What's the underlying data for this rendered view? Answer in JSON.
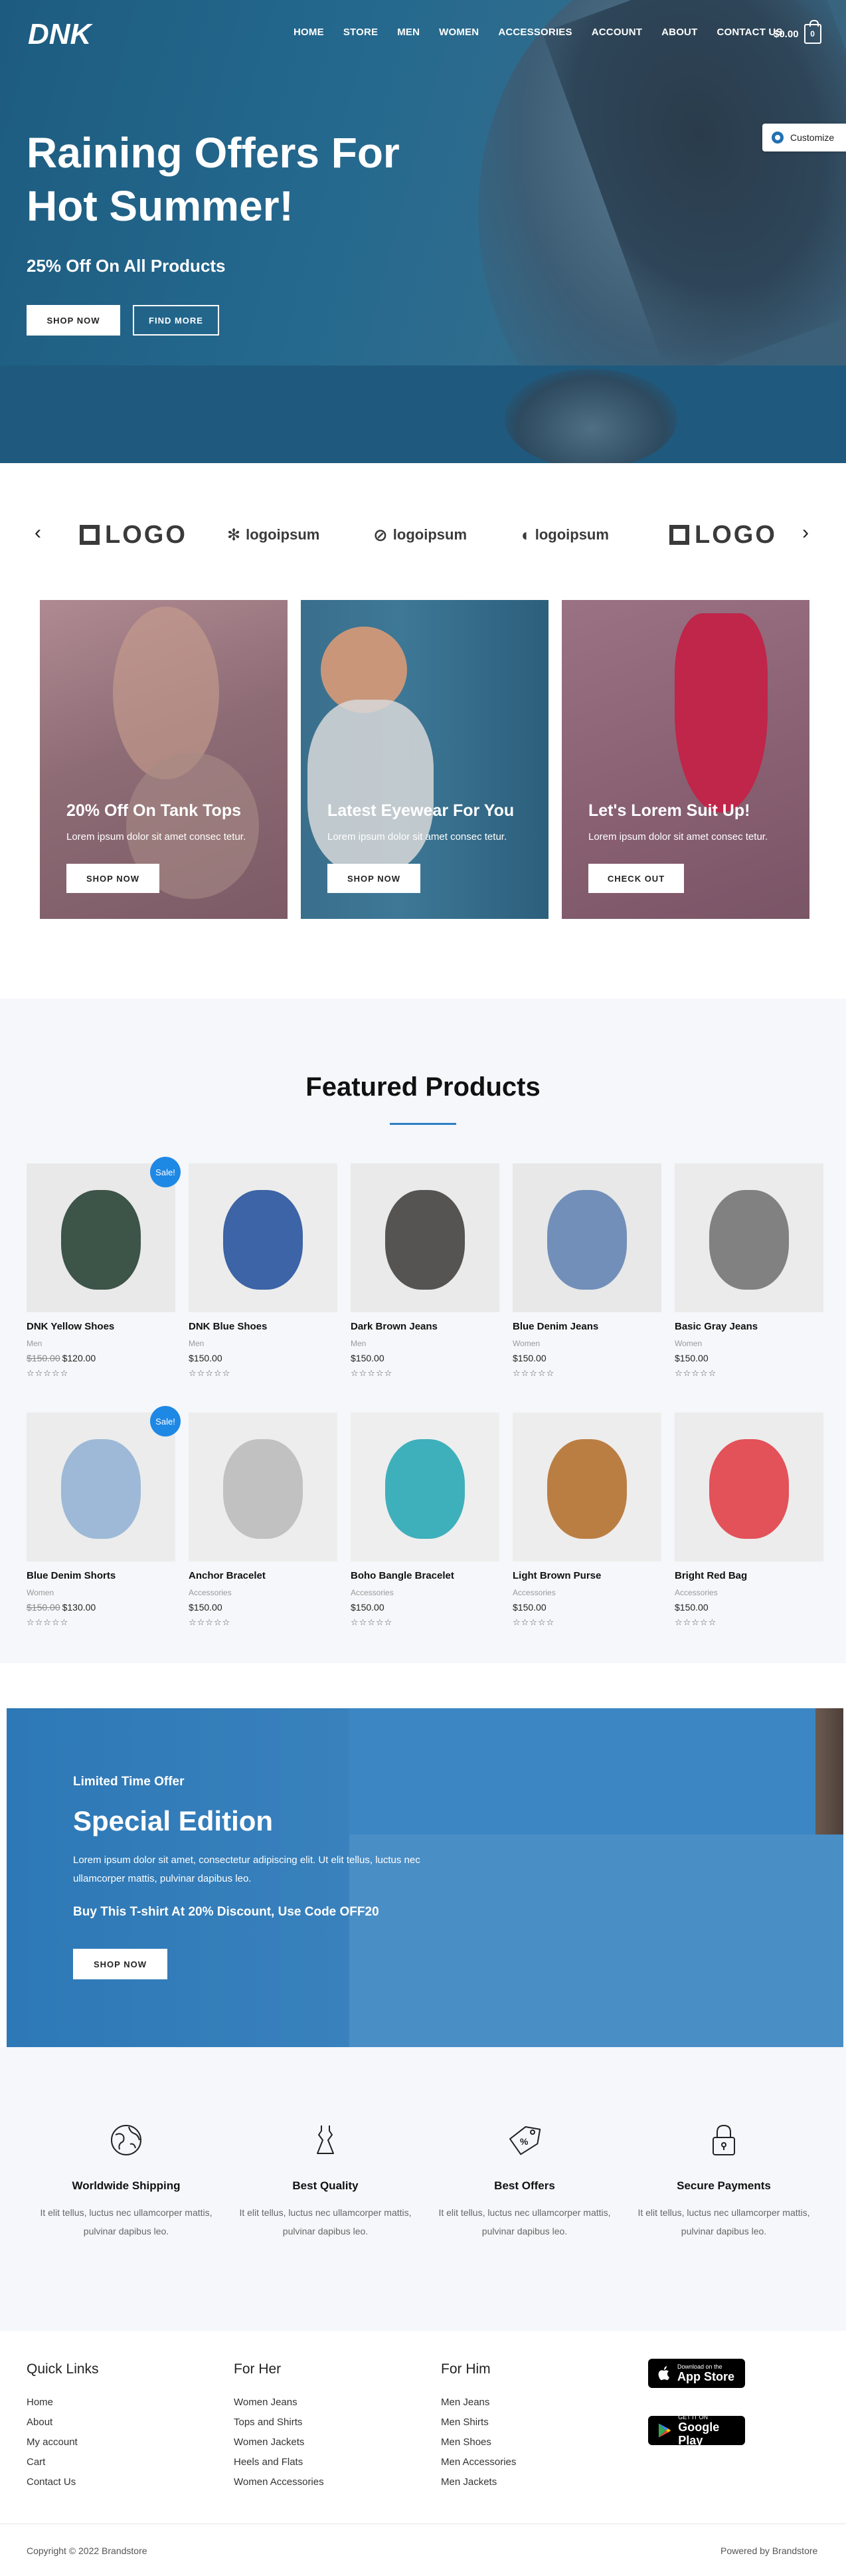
{
  "header": {
    "logo_text": "DNK",
    "nav": [
      "HOME",
      "STORE",
      "MEN",
      "WOMEN",
      "ACCESSORIES",
      "ACCOUNT",
      "ABOUT",
      "CONTACT US"
    ],
    "cart_total": "$0.00",
    "cart_count": "0"
  },
  "customize": {
    "label": "Customize"
  },
  "hero": {
    "title": "Raining Offers For Hot Summer!",
    "subtitle": "25% Off On All Products",
    "primary_button": "SHOP NOW",
    "secondary_button": "FIND MORE"
  },
  "logos": {
    "items": [
      "LOGO",
      "logoipsum",
      "logoipsum",
      "logoipsum",
      "LOGO"
    ]
  },
  "promos": [
    {
      "title": "20% Off On Tank Tops",
      "text": "Lorem ipsum dolor sit amet consec tetur.",
      "button": "SHOP NOW"
    },
    {
      "title": "Latest Eyewear For You",
      "text": "Lorem ipsum dolor sit amet consec tetur.",
      "button": "SHOP NOW"
    },
    {
      "title": "Let's Lorem Suit Up!",
      "text": "Lorem ipsum dolor sit amet consec tetur.",
      "button": "CHECK OUT"
    }
  ],
  "featured": {
    "title": "Featured Products",
    "sale_badge": "Sale!",
    "stars": "☆☆☆☆☆",
    "products": [
      {
        "name": "DNK Yellow Shoes",
        "category": "Men",
        "old_price": "$150.00",
        "price": "$120.00",
        "sale": true
      },
      {
        "name": "DNK Blue Shoes",
        "category": "Men",
        "old_price": "",
        "price": "$150.00",
        "sale": false
      },
      {
        "name": "Dark Brown Jeans",
        "category": "Men",
        "old_price": "",
        "price": "$150.00",
        "sale": false
      },
      {
        "name": "Blue Denim Jeans",
        "category": "Women",
        "old_price": "",
        "price": "$150.00",
        "sale": false
      },
      {
        "name": "Basic Gray Jeans",
        "category": "Women",
        "old_price": "",
        "price": "$150.00",
        "sale": false
      },
      {
        "name": "Blue Denim Shorts",
        "category": "Women",
        "old_price": "$150.00",
        "price": "$130.00",
        "sale": true
      },
      {
        "name": "Anchor Bracelet",
        "category": "Accessories",
        "old_price": "",
        "price": "$150.00",
        "sale": false
      },
      {
        "name": "Boho Bangle Bracelet",
        "category": "Accessories",
        "old_price": "",
        "price": "$150.00",
        "sale": false
      },
      {
        "name": "Light Brown Purse",
        "category": "Accessories",
        "old_price": "",
        "price": "$150.00",
        "sale": false
      },
      {
        "name": "Bright Red Bag",
        "category": "Accessories",
        "old_price": "",
        "price": "$150.00",
        "sale": false
      }
    ]
  },
  "special": {
    "eyebrow": "Limited Time Offer",
    "title": "Special Edition",
    "text": "Lorem ipsum dolor sit amet, consectetur adipiscing elit. Ut elit tellus, luctus nec ullamcorper mattis, pulvinar dapibus leo.",
    "offer": "Buy This T-shirt At 20% Discount, Use Code OFF20",
    "button": "SHOP NOW"
  },
  "features": [
    {
      "icon": "globe-icon",
      "title": "Worldwide Shipping",
      "text": "It elit tellus, luctus nec ullamcorper mattis, pulvinar dapibus leo."
    },
    {
      "icon": "dress-icon",
      "title": "Best Quality",
      "text": "It elit tellus, luctus nec ullamcorper mattis, pulvinar dapibus leo."
    },
    {
      "icon": "tag-icon",
      "title": "Best Offers",
      "text": "It elit tellus, luctus nec ullamcorper mattis, pulvinar dapibus leo."
    },
    {
      "icon": "lock-icon",
      "title": "Secure Payments",
      "text": "It elit tellus, luctus nec ullamcorper mattis, pulvinar dapibus leo."
    }
  ],
  "footer": {
    "quick_links": {
      "title": "Quick Links",
      "items": [
        "Home",
        "About",
        "My account",
        "Cart",
        "Contact Us"
      ]
    },
    "for_her": {
      "title": "For Her",
      "items": [
        "Women Jeans",
        "Tops and Shirts",
        "Women Jackets",
        "Heels and Flats",
        "Women Accessories"
      ]
    },
    "for_him": {
      "title": "For Him",
      "items": [
        "Men Jeans",
        "Men Shirts",
        "Men Shoes",
        "Men Accessories",
        "Men Jackets"
      ]
    },
    "app_store": {
      "small": "Download on the",
      "big": "App Store"
    },
    "google_play": {
      "small": "GET IT ON",
      "big": "Google Play"
    },
    "copyright": "Copyright © 2022 Brandstore",
    "powered": "Powered by Brandstore"
  },
  "colors": {
    "accent": "#1e88e5",
    "hero": "#25698f",
    "special": "#3881bd",
    "light_bg": "#f5f7fa"
  }
}
